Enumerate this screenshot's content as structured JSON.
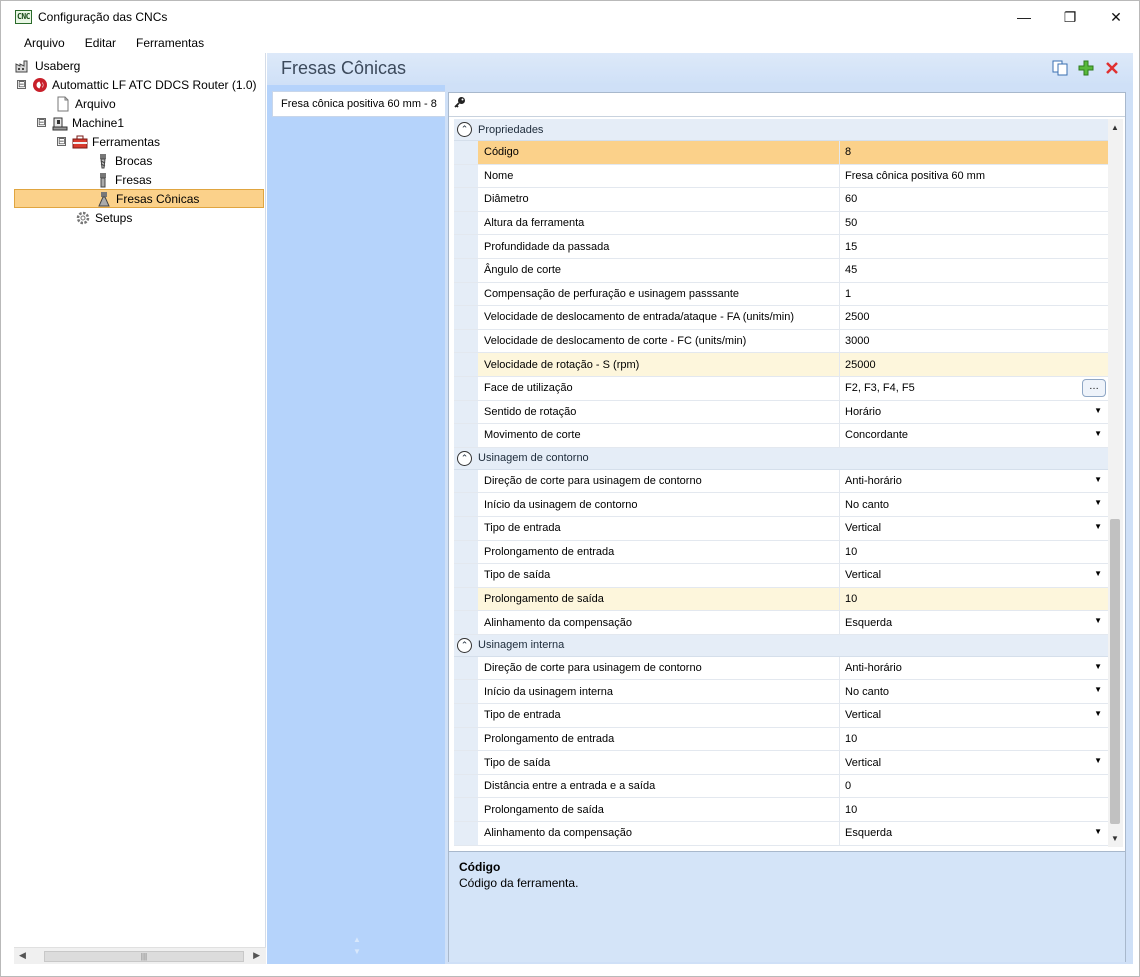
{
  "window": {
    "app_icon_text": "CNC",
    "title": "Configuração das CNCs",
    "minimize": "—",
    "maximize": "❐",
    "close": "✕"
  },
  "menu": [
    "Arquivo",
    "Editar",
    "Ferramentas"
  ],
  "tree": [
    {
      "label": "Usaberg",
      "icon": "factory-icon",
      "level": 0
    },
    {
      "label": "Automattic LF ATC DDCS Router (1.0)",
      "icon": "machine-brand-icon",
      "level": 0,
      "expander": "⊟"
    },
    {
      "label": "Arquivo",
      "icon": "file-icon",
      "level": 1
    },
    {
      "label": "Machine1",
      "icon": "machine-icon",
      "level": 1,
      "expander": "⊟"
    },
    {
      "label": "Ferramentas",
      "icon": "toolbox-icon",
      "level": 2,
      "expander": "⊟"
    },
    {
      "label": "Brocas",
      "icon": "drill-bit-icon",
      "level": 3
    },
    {
      "label": "Fresas",
      "icon": "mill-bit-icon",
      "level": 3
    },
    {
      "label": "Fresas Cônicas",
      "icon": "conical-mill-icon",
      "level": 3,
      "selected": true
    },
    {
      "label": "Setups",
      "icon": "gear-icon",
      "level": 2
    }
  ],
  "pane": {
    "title": "Fresas Cônicas",
    "tool_item": "Fresa cônica positiva 60 mm - 8"
  },
  "categories": [
    {
      "name": "Propriedades",
      "rows": [
        {
          "name": "Código",
          "value": "8",
          "state": "selected"
        },
        {
          "name": "Nome",
          "value": "Fresa cônica positiva 60 mm"
        },
        {
          "name": "Diâmetro",
          "value": "60"
        },
        {
          "name": "Altura da ferramenta",
          "value": "50"
        },
        {
          "name": "Profundidade da passada",
          "value": "15"
        },
        {
          "name": "Ângulo de corte",
          "value": "45"
        },
        {
          "name": "Compensação de perfuração e usinagem passsante",
          "value": "1"
        },
        {
          "name": "Velocidade de deslocamento de entrada/ataque - FA (units/min)",
          "value": "2500"
        },
        {
          "name": "Velocidade de deslocamento de corte - FC (units/min)",
          "value": "3000"
        },
        {
          "name": "Velocidade de rotação - S (rpm)",
          "value": "25000",
          "state": "highlight"
        },
        {
          "name": "Face de utilização",
          "value": "F2, F3, F4, F5",
          "control": "ellipsis"
        },
        {
          "name": "Sentido de rotação",
          "value": "Horário",
          "control": "dropdown"
        },
        {
          "name": "Movimento de corte",
          "value": "Concordante",
          "control": "dropdown"
        }
      ]
    },
    {
      "name": "Usinagem de contorno",
      "rows": [
        {
          "name": "Direção de corte para usinagem de contorno",
          "value": "Anti-horário",
          "control": "dropdown"
        },
        {
          "name": "Início da usinagem de contorno",
          "value": "No canto",
          "control": "dropdown"
        },
        {
          "name": "Tipo de entrada",
          "value": "Vertical",
          "control": "dropdown"
        },
        {
          "name": "Prolongamento de entrada",
          "value": "10"
        },
        {
          "name": "Tipo de saída",
          "value": "Vertical",
          "control": "dropdown"
        },
        {
          "name": "Prolongamento de saída",
          "value": "10",
          "state": "highlight"
        },
        {
          "name": "Alinhamento da compensação",
          "value": "Esquerda",
          "control": "dropdown"
        }
      ]
    },
    {
      "name": "Usinagem interna",
      "rows": [
        {
          "name": "Direção de corte para usinagem de contorno",
          "value": "Anti-horário",
          "control": "dropdown"
        },
        {
          "name": "Início da usinagem interna",
          "value": "No canto",
          "control": "dropdown"
        },
        {
          "name": "Tipo de entrada",
          "value": "Vertical",
          "control": "dropdown"
        },
        {
          "name": "Prolongamento de entrada",
          "value": "10"
        },
        {
          "name": "Tipo de saída",
          "value": "Vertical",
          "control": "dropdown"
        },
        {
          "name": "Distância entre a entrada e a saída",
          "value": "0"
        },
        {
          "name": "Prolongamento de saída",
          "value": "10"
        },
        {
          "name": "Alinhamento da compensação",
          "value": "Esquerda",
          "control": "dropdown"
        }
      ]
    }
  ],
  "description": {
    "title": "Código",
    "text": "Código da ferramenta."
  },
  "colors": {
    "selection": "#fbd18a",
    "highlight": "#fdf6dc",
    "pane_bg": "#cfe0f7",
    "list_bg": "#b5d3fb"
  }
}
